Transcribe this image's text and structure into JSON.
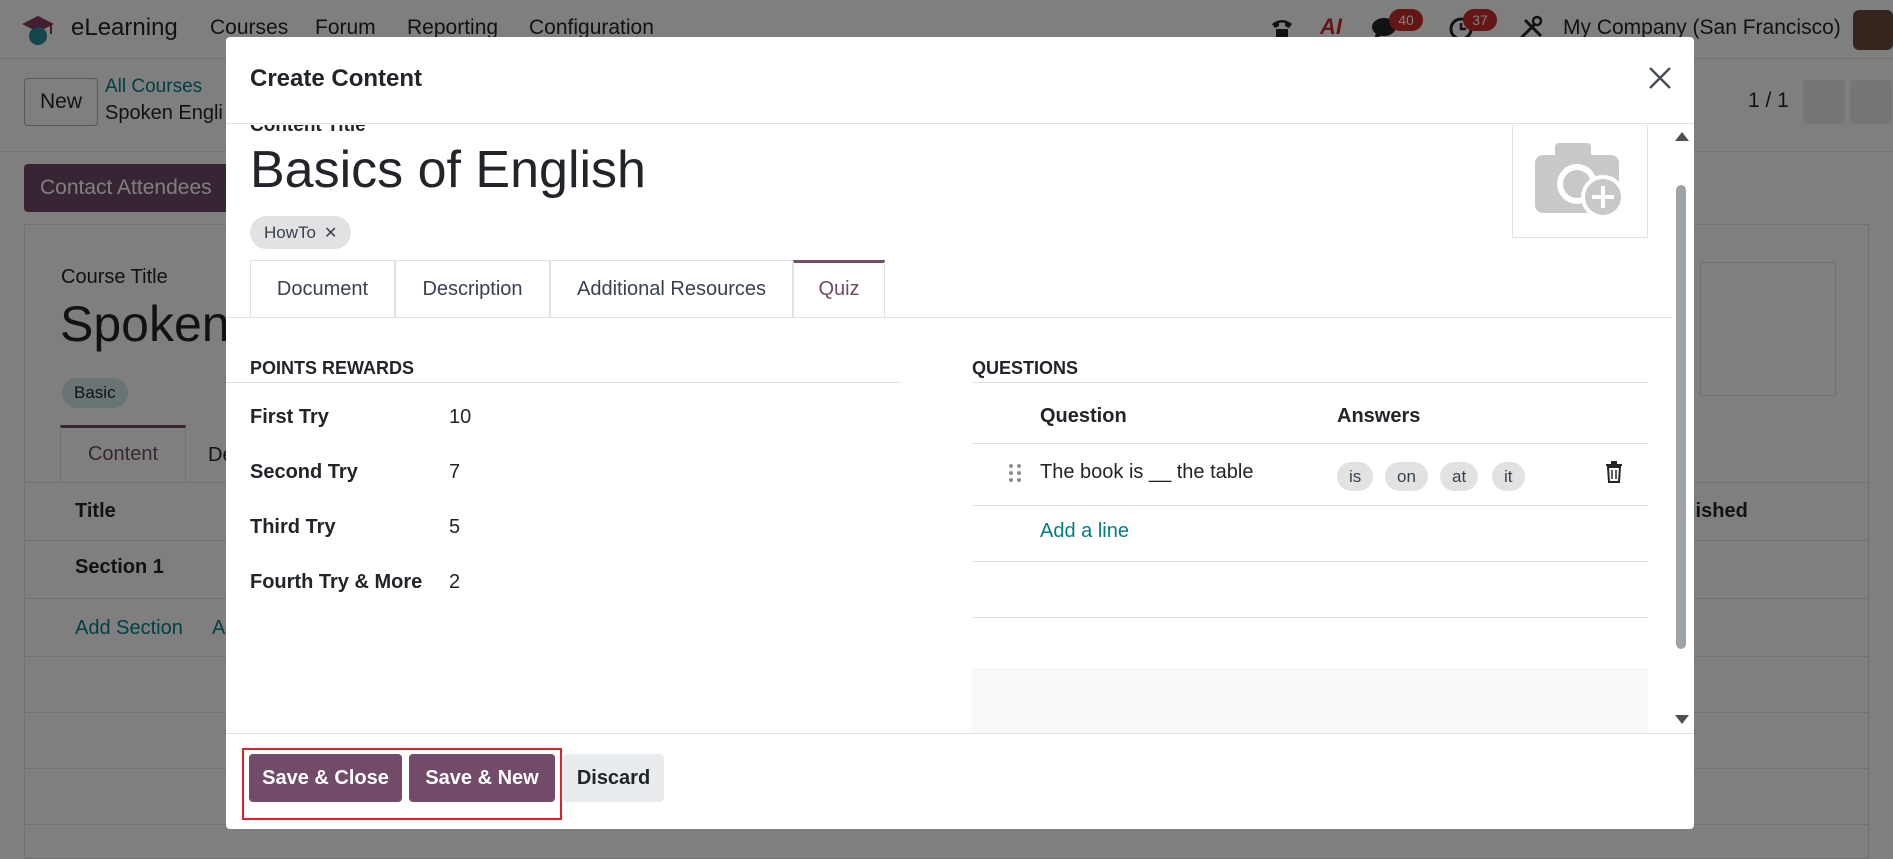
{
  "topnav": {
    "app_name": "eLearning",
    "menu": [
      "Courses",
      "Forum",
      "Reporting",
      "Configuration"
    ],
    "ai_label": "AI",
    "messages_badge": "40",
    "activities_badge": "37",
    "company": "My Company (San Francisco)"
  },
  "control_panel": {
    "new_label": "New",
    "breadcrumb_parent": "All Courses",
    "breadcrumb_current": "Spoken Engli",
    "pager": "1 / 1"
  },
  "background": {
    "contact_button": "Contact Attendees",
    "course_title_label": "Course Title",
    "course_title": "Spoken",
    "course_tag": "Basic",
    "tab_content": "Content",
    "tab_partial": "De",
    "col_title": "Title",
    "col_published": "lished",
    "section_row": "Section 1",
    "add_section": "Add Section",
    "add_partial": "A"
  },
  "modal": {
    "title": "Create Content",
    "content_title_label": "Content Title",
    "content_title": "Basics of English",
    "tag": "HowTo",
    "tabs": [
      "Document",
      "Description",
      "Additional Resources",
      "Quiz"
    ],
    "active_tab": "Quiz",
    "points_rewards": {
      "heading": "POINTS REWARDS",
      "rows": [
        {
          "label": "First Try",
          "value": "10"
        },
        {
          "label": "Second Try",
          "value": "7"
        },
        {
          "label": "Third Try",
          "value": "5"
        },
        {
          "label": "Fourth Try & More",
          "value": "2"
        }
      ]
    },
    "questions": {
      "heading": "QUESTIONS",
      "col_question": "Question",
      "col_answers": "Answers",
      "rows": [
        {
          "question": "The book is __ the table",
          "answers": [
            "is",
            "on",
            "at",
            "it"
          ]
        }
      ],
      "add_line": "Add a line"
    },
    "footer": {
      "save_close": "Save & Close",
      "save_new": "Save & New",
      "discard": "Discard"
    }
  },
  "colors": {
    "primary": "#714b67",
    "link": "#017e84",
    "highlight": "#e0202a"
  }
}
